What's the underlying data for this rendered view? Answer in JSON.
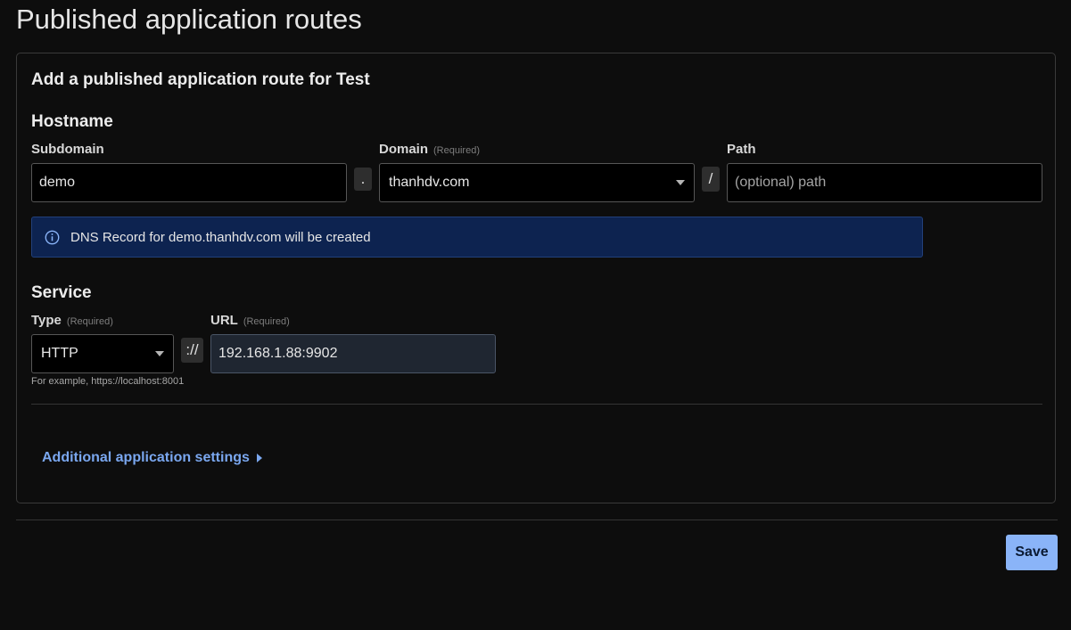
{
  "page": {
    "title": "Published application routes"
  },
  "card": {
    "title": "Add a published application route for Test"
  },
  "hostname": {
    "section_title": "Hostname",
    "subdomain": {
      "label": "Subdomain",
      "value": "demo"
    },
    "dot_separator": ".",
    "domain": {
      "label": "Domain",
      "required": "(Required)",
      "selected": "thanhdv.com"
    },
    "slash_separator": "/",
    "path": {
      "label": "Path",
      "placeholder": "(optional) path",
      "value": ""
    }
  },
  "info_banner": {
    "icon": "info-icon",
    "text": "DNS Record for demo.thanhdv.com will be created",
    "color": "#0d2350"
  },
  "service": {
    "section_title": "Service",
    "type": {
      "label": "Type",
      "required": "(Required)",
      "selected": "HTTP"
    },
    "scheme_separator": "://",
    "url": {
      "label": "URL",
      "required": "(Required)",
      "value": "192.168.1.88:9902"
    },
    "hint": "For example, https://localhost:8001"
  },
  "additional_settings": {
    "label": "Additional application settings",
    "icon": "chevron-right-icon"
  },
  "footer": {
    "save_label": "Save",
    "accent": "#8ab4f8"
  }
}
